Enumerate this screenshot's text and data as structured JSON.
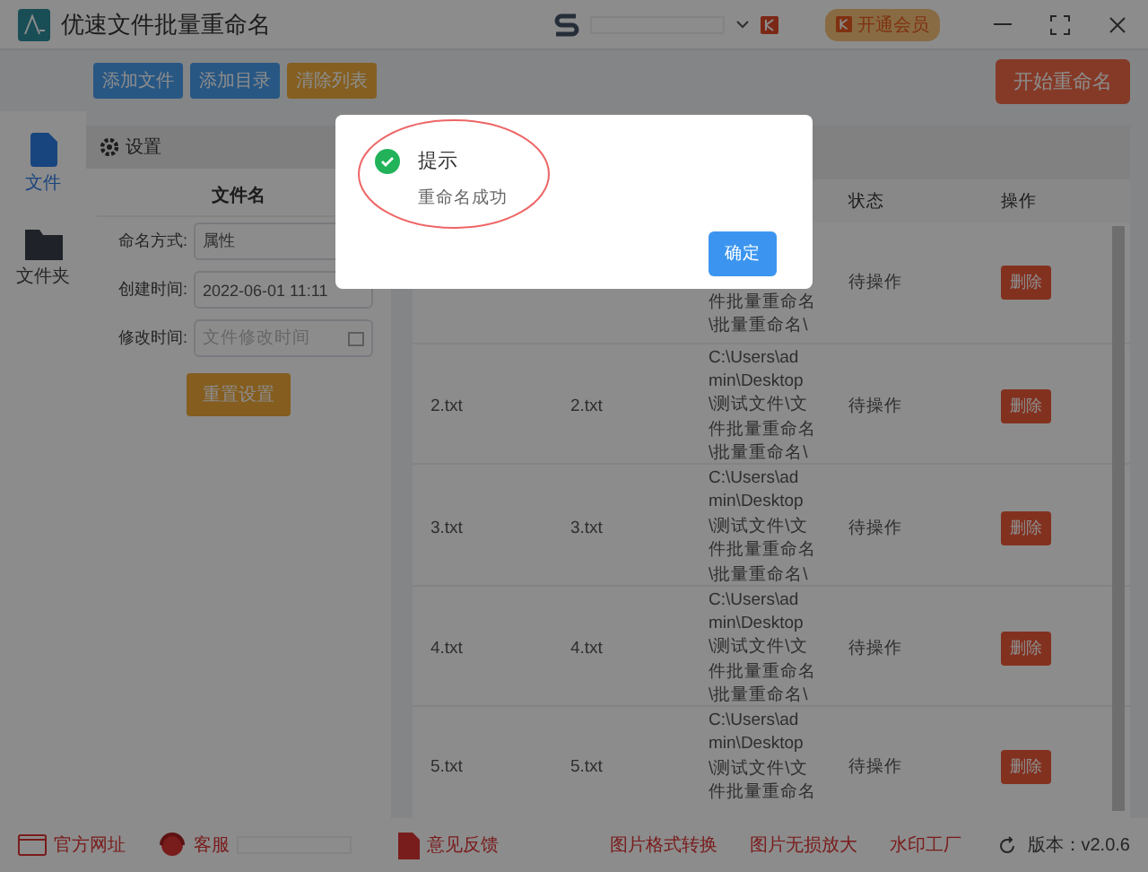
{
  "window": {
    "title": "优速文件批量重命名"
  },
  "account": {
    "vip_label": "开通会员"
  },
  "toolbar": {
    "buttons": [
      {
        "label": "添加文件",
        "kind": "primary"
      },
      {
        "label": "添加目录",
        "kind": "primary"
      },
      {
        "label": "清除列表",
        "kind": "warning"
      }
    ],
    "start_label": "开始重命名"
  },
  "sidebar": {
    "items": [
      {
        "label": "文件",
        "kind": "file",
        "selected": true
      },
      {
        "label": "文件夹",
        "kind": "folder",
        "selected": false
      }
    ]
  },
  "settings": {
    "title": "设置",
    "section": "文件名",
    "fields": [
      {
        "label": "命名方式:",
        "value": "属性",
        "kind": "select"
      },
      {
        "label": "创建时间:",
        "value": "2022-06-01 11:11",
        "kind": "text"
      },
      {
        "label": "修改时间:",
        "placeholder": "文件修改时间",
        "kind": "date"
      }
    ],
    "reset_label": "重置设置"
  },
  "table": {
    "columns": [
      "状态",
      "操作"
    ],
    "rows": [
      {
        "name": "",
        "new_name": "",
        "path": [
          "件批量重命名",
          "\\批量重命名\\"
        ],
        "status": "待操作",
        "action": "删除"
      },
      {
        "name": "2.txt",
        "new_name": "2.txt",
        "path": [
          "C:\\Users\\ad",
          "min\\Desktop",
          "\\测试文件\\文",
          "件批量重命名",
          "\\批量重命名\\"
        ],
        "status": "待操作",
        "action": "删除"
      },
      {
        "name": "3.txt",
        "new_name": "3.txt",
        "path": [
          "C:\\Users\\ad",
          "min\\Desktop",
          "\\测试文件\\文",
          "件批量重命名",
          "\\批量重命名\\"
        ],
        "status": "待操作",
        "action": "删除"
      },
      {
        "name": "4.txt",
        "new_name": "4.txt",
        "path": [
          "C:\\Users\\ad",
          "min\\Desktop",
          "\\测试文件\\文",
          "件批量重命名",
          "\\批量重命名\\"
        ],
        "status": "待操作",
        "action": "删除"
      },
      {
        "name": "5.txt",
        "new_name": "5.txt",
        "path": [
          "C:\\Users\\ad",
          "min\\Desktop",
          "\\测试文件\\文",
          "件批量重命名"
        ],
        "status": "待操作",
        "action": "删除"
      }
    ]
  },
  "footer": {
    "links": [
      {
        "label": "官方网址",
        "kind": "web"
      },
      {
        "label": "客服",
        "kind": "support"
      },
      {
        "label": "意见反馈",
        "kind": "feedback"
      },
      {
        "label": "图片格式转换",
        "kind": "plain"
      },
      {
        "label": "图片无损放大",
        "kind": "plain"
      },
      {
        "label": "水印工厂",
        "kind": "plain"
      }
    ],
    "version": "版本：v2.0.6"
  },
  "dialog": {
    "title": "提示",
    "message": "重命名成功",
    "ok_label": "确定"
  }
}
